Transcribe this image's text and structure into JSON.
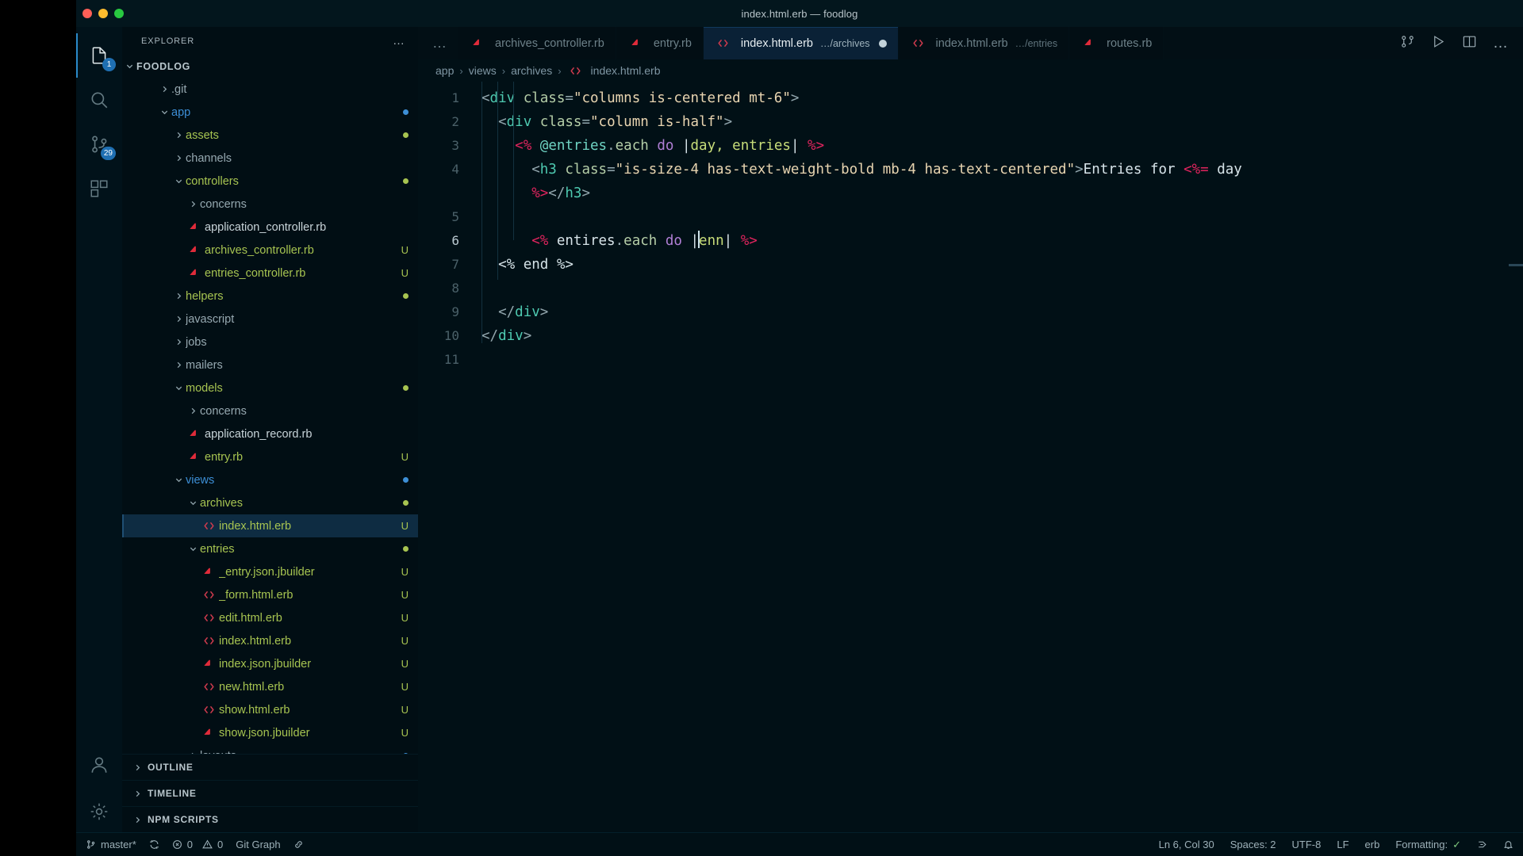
{
  "window": {
    "title": "index.html.erb — foodlog"
  },
  "activitybar": {
    "items": [
      {
        "name": "explorer",
        "icon": "files-icon",
        "badge": "1",
        "active": true
      },
      {
        "name": "search",
        "icon": "search-icon",
        "badge": "",
        "active": false
      },
      {
        "name": "source-control",
        "icon": "source-control-icon",
        "badge": "29",
        "active": false
      },
      {
        "name": "extensions",
        "icon": "extensions-icon",
        "badge": "",
        "active": false
      }
    ],
    "bottom": [
      {
        "name": "accounts",
        "icon": "account-icon"
      },
      {
        "name": "manage",
        "icon": "gear-icon"
      }
    ]
  },
  "explorer": {
    "header_title": "EXPLORER",
    "header_actions": "…",
    "root": "FOODLOG",
    "tree": [
      {
        "label": ".git",
        "indent": 1,
        "type": "folder",
        "expanded": false,
        "color": "gray",
        "git": "",
        "dot": ""
      },
      {
        "label": "app",
        "indent": 1,
        "type": "folder",
        "expanded": true,
        "color": "blue",
        "git": "",
        "dot": "#3d8fd6"
      },
      {
        "label": "assets",
        "indent": 2,
        "type": "folder",
        "expanded": false,
        "color": "green",
        "git": "",
        "dot": "#a7c451"
      },
      {
        "label": "channels",
        "indent": 2,
        "type": "folder",
        "expanded": false,
        "color": "gray",
        "git": "",
        "dot": ""
      },
      {
        "label": "controllers",
        "indent": 2,
        "type": "folder",
        "expanded": true,
        "color": "green",
        "git": "",
        "dot": "#a7c451"
      },
      {
        "label": "concerns",
        "indent": 3,
        "type": "folder",
        "expanded": false,
        "color": "gray",
        "git": "",
        "dot": ""
      },
      {
        "label": "application_controller.rb",
        "indent": 3,
        "type": "ruby",
        "expanded": null,
        "color": "white",
        "git": "",
        "dot": ""
      },
      {
        "label": "archives_controller.rb",
        "indent": 3,
        "type": "ruby",
        "expanded": null,
        "color": "green",
        "git": "U",
        "dot": ""
      },
      {
        "label": "entries_controller.rb",
        "indent": 3,
        "type": "ruby",
        "expanded": null,
        "color": "green",
        "git": "U",
        "dot": ""
      },
      {
        "label": "helpers",
        "indent": 2,
        "type": "folder",
        "expanded": false,
        "color": "green",
        "git": "",
        "dot": "#a7c451"
      },
      {
        "label": "javascript",
        "indent": 2,
        "type": "folder",
        "expanded": false,
        "color": "gray",
        "git": "",
        "dot": ""
      },
      {
        "label": "jobs",
        "indent": 2,
        "type": "folder",
        "expanded": false,
        "color": "gray",
        "git": "",
        "dot": ""
      },
      {
        "label": "mailers",
        "indent": 2,
        "type": "folder",
        "expanded": false,
        "color": "gray",
        "git": "",
        "dot": ""
      },
      {
        "label": "models",
        "indent": 2,
        "type": "folder",
        "expanded": true,
        "color": "green",
        "git": "",
        "dot": "#a7c451"
      },
      {
        "label": "concerns",
        "indent": 3,
        "type": "folder",
        "expanded": false,
        "color": "gray",
        "git": "",
        "dot": ""
      },
      {
        "label": "application_record.rb",
        "indent": 3,
        "type": "ruby",
        "expanded": null,
        "color": "white",
        "git": "",
        "dot": ""
      },
      {
        "label": "entry.rb",
        "indent": 3,
        "type": "ruby",
        "expanded": null,
        "color": "green",
        "git": "U",
        "dot": ""
      },
      {
        "label": "views",
        "indent": 2,
        "type": "folder",
        "expanded": true,
        "color": "blue",
        "git": "",
        "dot": "#3d8fd6"
      },
      {
        "label": "archives",
        "indent": 3,
        "type": "folder",
        "expanded": true,
        "color": "green",
        "git": "",
        "dot": "#a7c451"
      },
      {
        "label": "index.html.erb",
        "indent": 4,
        "type": "erb",
        "expanded": null,
        "color": "green",
        "git": "U",
        "dot": "",
        "selected": true
      },
      {
        "label": "entries",
        "indent": 3,
        "type": "folder",
        "expanded": true,
        "color": "green",
        "git": "",
        "dot": "#a7c451"
      },
      {
        "label": "_entry.json.jbuilder",
        "indent": 4,
        "type": "ruby",
        "expanded": null,
        "color": "green",
        "git": "U",
        "dot": ""
      },
      {
        "label": "_form.html.erb",
        "indent": 4,
        "type": "erb",
        "expanded": null,
        "color": "green",
        "git": "U",
        "dot": ""
      },
      {
        "label": "edit.html.erb",
        "indent": 4,
        "type": "erb",
        "expanded": null,
        "color": "green",
        "git": "U",
        "dot": ""
      },
      {
        "label": "index.html.erb",
        "indent": 4,
        "type": "erb",
        "expanded": null,
        "color": "green",
        "git": "U",
        "dot": ""
      },
      {
        "label": "index.json.jbuilder",
        "indent": 4,
        "type": "ruby",
        "expanded": null,
        "color": "green",
        "git": "U",
        "dot": ""
      },
      {
        "label": "new.html.erb",
        "indent": 4,
        "type": "erb",
        "expanded": null,
        "color": "green",
        "git": "U",
        "dot": ""
      },
      {
        "label": "show.html.erb",
        "indent": 4,
        "type": "erb",
        "expanded": null,
        "color": "green",
        "git": "U",
        "dot": ""
      },
      {
        "label": "show.json.jbuilder",
        "indent": 4,
        "type": "ruby",
        "expanded": null,
        "color": "green",
        "git": "U",
        "dot": ""
      },
      {
        "label": "layouts",
        "indent": 3,
        "type": "folder",
        "expanded": false,
        "color": "gray",
        "git": "",
        "dot": "#3d8fd6"
      }
    ],
    "sections": [
      {
        "label": "OUTLINE"
      },
      {
        "label": "TIMELINE"
      },
      {
        "label": "NPM SCRIPTS"
      }
    ]
  },
  "tabs": {
    "overflow_indicator": "…",
    "items": [
      {
        "name": "archives_controller.rb",
        "path": "",
        "icon": "ruby-icon",
        "active": false,
        "dirty": false
      },
      {
        "name": "entry.rb",
        "path": "",
        "icon": "ruby-icon",
        "active": false,
        "dirty": false
      },
      {
        "name": "index.html.erb",
        "path": "…/archives",
        "icon": "erb-icon",
        "active": true,
        "dirty": true
      },
      {
        "name": "index.html.erb",
        "path": "…/entries",
        "icon": "erb-icon",
        "active": false,
        "dirty": false
      },
      {
        "name": "routes.rb",
        "path": "",
        "icon": "ruby-icon",
        "active": false,
        "dirty": false
      }
    ],
    "actions": [
      {
        "name": "split-compare-icon"
      },
      {
        "name": "run-play-icon"
      },
      {
        "name": "split-editor-icon"
      },
      {
        "name": "more-actions-icon"
      }
    ]
  },
  "breadcrumb": {
    "items": [
      "app",
      "views",
      "archives",
      "index.html.erb"
    ],
    "separator": "›",
    "file_icon": "erb-icon"
  },
  "editor": {
    "lines": [
      {
        "number": "1",
        "tokens": [
          {
            "t": "<",
            "c": "t-punct"
          },
          {
            "t": "div",
            "c": "t-tag"
          },
          {
            "t": " ",
            "c": "t-plain"
          },
          {
            "t": "class",
            "c": "t-attr"
          },
          {
            "t": "=",
            "c": "t-punct"
          },
          {
            "t": "\"columns is-centered mt-6\"",
            "c": "t-str"
          },
          {
            "t": ">",
            "c": "t-punct"
          }
        ]
      },
      {
        "number": "2",
        "tokens": [
          {
            "t": "  ",
            "c": "t-plain"
          },
          {
            "t": "<",
            "c": "t-punct"
          },
          {
            "t": "div",
            "c": "t-tag"
          },
          {
            "t": " ",
            "c": "t-plain"
          },
          {
            "t": "class",
            "c": "t-attr"
          },
          {
            "t": "=",
            "c": "t-punct"
          },
          {
            "t": "\"column is-half\"",
            "c": "t-str"
          },
          {
            "t": ">",
            "c": "t-punct"
          }
        ]
      },
      {
        "number": "3",
        "tokens": [
          {
            "t": "    ",
            "c": "t-plain"
          },
          {
            "t": "<%",
            "c": "t-erb"
          },
          {
            "t": " ",
            "c": "t-plain"
          },
          {
            "t": "@entries",
            "c": "t-ivar"
          },
          {
            "t": ".",
            "c": "t-punct"
          },
          {
            "t": "each",
            "c": "t-meth"
          },
          {
            "t": " ",
            "c": "t-plain"
          },
          {
            "t": "do",
            "c": "t-kw"
          },
          {
            "t": " ",
            "c": "t-plain"
          },
          {
            "t": "|",
            "c": "t-plain"
          },
          {
            "t": "day, entries",
            "c": "t-var"
          },
          {
            "t": "|",
            "c": "t-plain"
          },
          {
            "t": " ",
            "c": "t-plain"
          },
          {
            "t": "%>",
            "c": "t-erb"
          }
        ]
      },
      {
        "number": "4",
        "wrapped": true,
        "tokens": [
          {
            "t": "      ",
            "c": "t-plain"
          },
          {
            "t": "<",
            "c": "t-punct"
          },
          {
            "t": "h3",
            "c": "t-tag"
          },
          {
            "t": " ",
            "c": "t-plain"
          },
          {
            "t": "class",
            "c": "t-attr"
          },
          {
            "t": "=",
            "c": "t-punct"
          },
          {
            "t": "\"is-size-4 has-text-weight-bold mb-4 has-text-centered\"",
            "c": "t-str"
          },
          {
            "t": ">",
            "c": "t-punct"
          },
          {
            "t": "Entries for ",
            "c": "t-txt"
          },
          {
            "t": "<%=",
            "c": "t-erb"
          },
          {
            "t": " day",
            "c": "t-plain"
          }
        ],
        "tokens2": [
          {
            "t": "      ",
            "c": "t-plain"
          },
          {
            "t": "%>",
            "c": "t-erb"
          },
          {
            "t": "</",
            "c": "t-punct"
          },
          {
            "t": "h3",
            "c": "t-tag"
          },
          {
            "t": ">",
            "c": "t-punct"
          }
        ]
      },
      {
        "number": "5",
        "tokens": []
      },
      {
        "number": "6",
        "current": true,
        "tokens": [
          {
            "t": "      ",
            "c": "t-plain"
          },
          {
            "t": "<%",
            "c": "t-erb"
          },
          {
            "t": " ",
            "c": "t-plain"
          },
          {
            "t": "entires",
            "c": "t-plain"
          },
          {
            "t": ".",
            "c": "t-punct"
          },
          {
            "t": "each",
            "c": "t-meth"
          },
          {
            "t": " ",
            "c": "t-plain"
          },
          {
            "t": "do",
            "c": "t-kw"
          },
          {
            "t": " ",
            "c": "t-plain"
          },
          {
            "t": "|",
            "c": "t-plain"
          },
          {
            "t": "CURSOR",
            "c": "cursor"
          },
          {
            "t": "enn",
            "c": "t-var"
          },
          {
            "t": "|",
            "c": "t-plain"
          },
          {
            "t": " ",
            "c": "t-plain"
          },
          {
            "t": "%>",
            "c": "t-erb"
          }
        ]
      },
      {
        "number": "7",
        "tokens": [
          {
            "t": "  ",
            "c": "t-plain"
          },
          {
            "t": "<%",
            "c": "t-plain"
          },
          {
            "t": " end ",
            "c": "t-plain"
          },
          {
            "t": "%>",
            "c": "t-plain"
          }
        ]
      },
      {
        "number": "8",
        "tokens": []
      },
      {
        "number": "9",
        "tokens": [
          {
            "t": "  ",
            "c": "t-plain"
          },
          {
            "t": "</",
            "c": "t-punct"
          },
          {
            "t": "div",
            "c": "t-tag"
          },
          {
            "t": ">",
            "c": "t-punct"
          }
        ]
      },
      {
        "number": "10",
        "tokens": [
          {
            "t": "</",
            "c": "t-punct"
          },
          {
            "t": "div",
            "c": "t-tag"
          },
          {
            "t": ">",
            "c": "t-punct"
          }
        ]
      },
      {
        "number": "11",
        "tokens": []
      }
    ]
  },
  "statusbar": {
    "left": [
      {
        "name": "branch",
        "icon": "source-control-icon",
        "text": "master*"
      },
      {
        "name": "sync",
        "icon": "sync-icon",
        "text": ""
      },
      {
        "name": "problems",
        "icon": "error-warning-icon",
        "text": "0  0",
        "errors": "0",
        "warnings": "0"
      },
      {
        "name": "git-graph",
        "icon": "",
        "text": "Git Graph"
      },
      {
        "name": "live-share",
        "icon": "live-share-icon",
        "text": ""
      }
    ],
    "right": [
      {
        "name": "cursor-position",
        "text": "Ln 6, Col 30"
      },
      {
        "name": "indentation",
        "text": "Spaces: 2"
      },
      {
        "name": "encoding",
        "text": "UTF-8"
      },
      {
        "name": "eol",
        "text": "LF"
      },
      {
        "name": "language-mode",
        "text": "erb"
      },
      {
        "name": "formatting",
        "text": "Formatting:",
        "check": "✓"
      },
      {
        "name": "remote-host",
        "icon": "remote-icon",
        "text": ""
      },
      {
        "name": "notifications",
        "icon": "bell-icon",
        "text": ""
      }
    ]
  }
}
